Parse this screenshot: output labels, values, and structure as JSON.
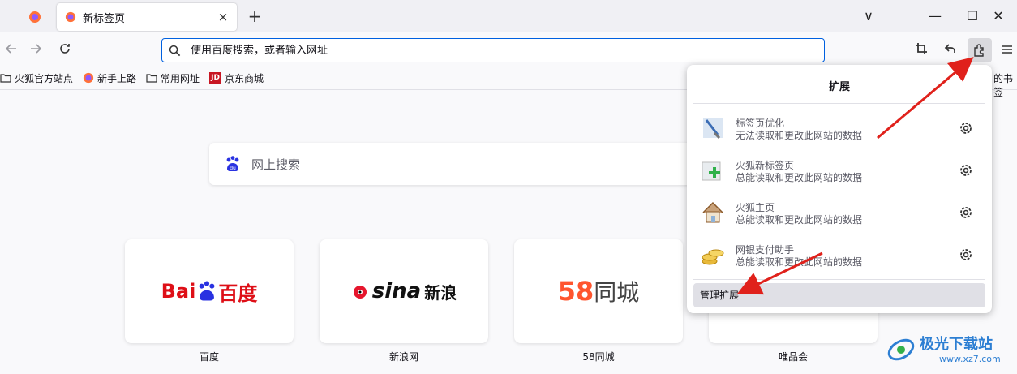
{
  "tabs": {
    "active_title": "新标签页",
    "close_glyph": "×",
    "new_tab_glyph": "+"
  },
  "window": {
    "menu_glyph": "∨",
    "minimize_glyph": "—",
    "maximize_glyph": "☐",
    "close_glyph": "✕"
  },
  "urlbar": {
    "placeholder": "使用百度搜索，或者输入网址"
  },
  "bookmarks": [
    {
      "label": "火狐官方站点",
      "icon": "folder-icon"
    },
    {
      "label": "新手上路",
      "icon": "firefox-icon"
    },
    {
      "label": "常用网址",
      "icon": "folder-icon"
    },
    {
      "label": "京东商城",
      "icon": "jd-icon"
    }
  ],
  "bookmarks_overflow_label": "的书签",
  "search": {
    "placeholder": "网上搜索"
  },
  "tiles": [
    {
      "label": "百度",
      "logo_text": "Bai",
      "logo_text2": "百度"
    },
    {
      "label": "新浪网",
      "logo_text": "sina",
      "logo_text2": "新浪"
    },
    {
      "label": "58同城",
      "logo_text": "58",
      "logo_text2": "同城"
    },
    {
      "label": "唯品会"
    }
  ],
  "extensions_panel": {
    "title": "扩展",
    "items": [
      {
        "name": "标签页优化",
        "desc": "无法读取和更改此网站的数据",
        "icon": "brush-icon"
      },
      {
        "name": "火狐新标签页",
        "desc": "总能读取和更改此网站的数据",
        "icon": "new-tab-plus-icon"
      },
      {
        "name": "火狐主页",
        "desc": "总能读取和更改此网站的数据",
        "icon": "house-icon"
      },
      {
        "name": "网银支付助手",
        "desc": "总能读取和更改此网站的数据",
        "icon": "coins-icon"
      }
    ],
    "manage_label": "管理扩展"
  },
  "watermark": {
    "text": "极光下载站",
    "url": "www.xz7.com"
  },
  "colors": {
    "accent": "#0061e0",
    "arrow": "#e0211b",
    "baidu_red": "#de0f17",
    "baidu_blue": "#2932e1"
  }
}
